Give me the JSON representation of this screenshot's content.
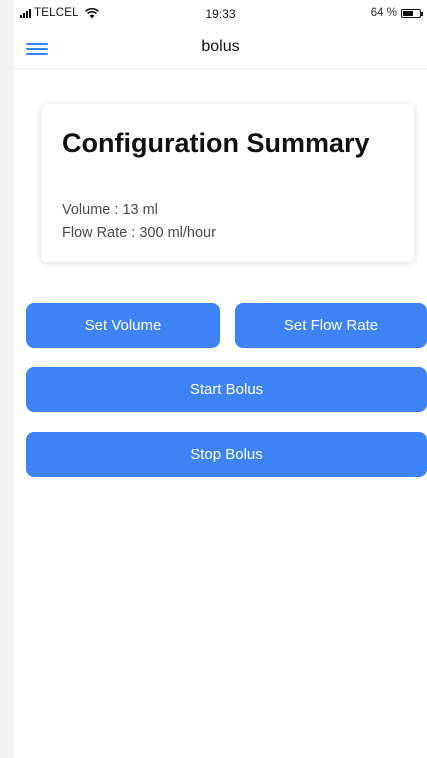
{
  "status_bar": {
    "carrier": "TELCEL",
    "time": "19:33",
    "battery_percent": "64 %",
    "battery_level": 0.64
  },
  "header": {
    "title": "bolus",
    "menu_icon": "hamburger-menu-icon",
    "accent_color": "#2f86f6"
  },
  "summary": {
    "title": "Configuration Summary",
    "volume_line": "Volume : 13 ml",
    "flow_rate_line": "Flow Rate : 300 ml/hour"
  },
  "buttons": {
    "set_volume": "Set Volume",
    "set_flow_rate": "Set Flow Rate",
    "start_bolus": "Start Bolus",
    "stop_bolus": "Stop Bolus",
    "color": "#3d83f6"
  }
}
